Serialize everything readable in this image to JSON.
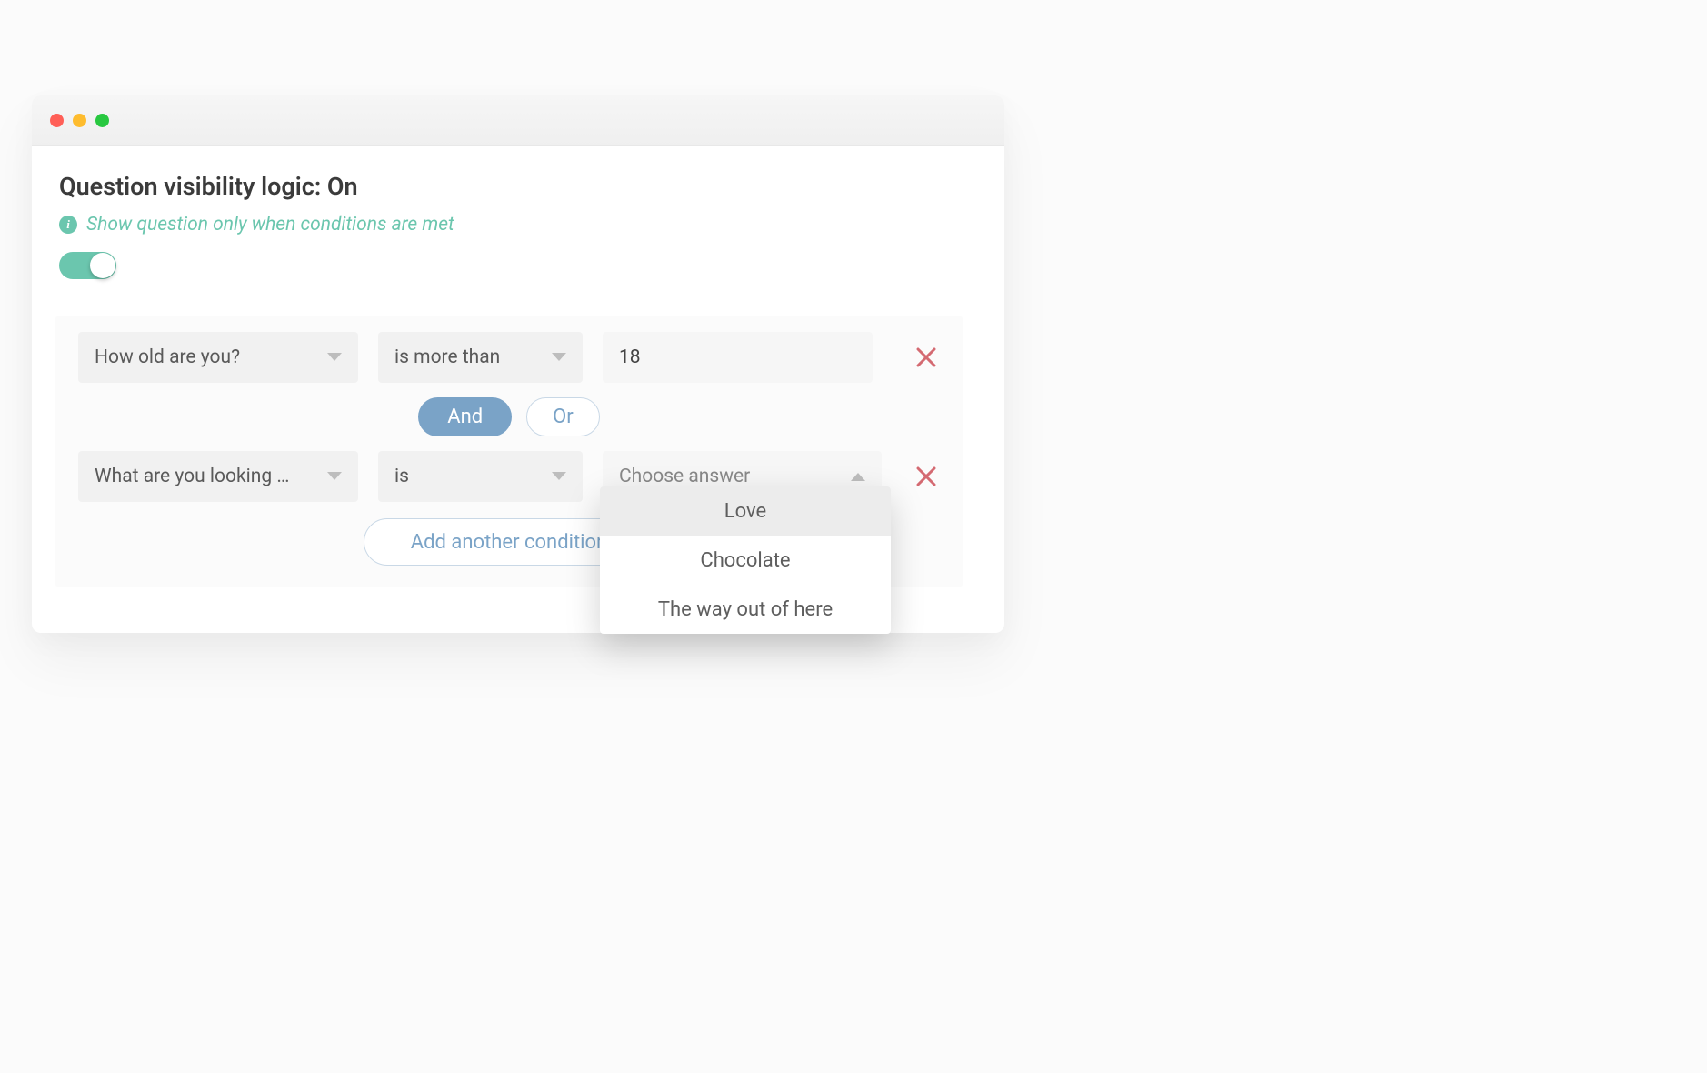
{
  "header": {
    "title": "Question visibility logic: On",
    "hint": "Show question only when conditions are met"
  },
  "toggle": {
    "on": true
  },
  "combiners": {
    "and_label": "And",
    "or_label": "Or",
    "selected": "and"
  },
  "rules": [
    {
      "question": "How old are you?",
      "operator": "is more than",
      "value": "18",
      "value_type": "text"
    },
    {
      "question": "What are you looking …",
      "operator": "is",
      "value_placeholder": "Choose answer",
      "value_type": "dropdown_open"
    }
  ],
  "answer_options": [
    "Love",
    "Chocolate",
    "The way out of here"
  ],
  "add_button_label": "Add another condition",
  "colors": {
    "accent_teal": "#6bc6ae",
    "accent_blue": "#7aa3c7",
    "delete_red": "#d46a72"
  }
}
